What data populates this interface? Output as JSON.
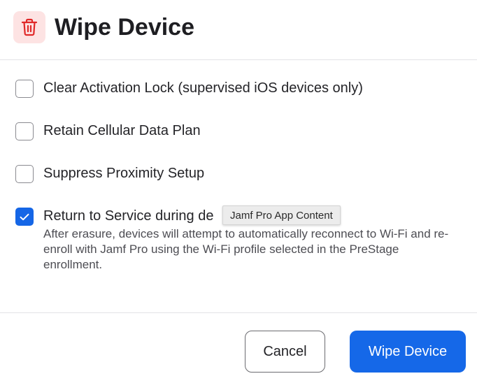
{
  "dialog": {
    "title": "Wipe Device",
    "icon": "trash-icon"
  },
  "options": [
    {
      "label": "Clear Activation Lock (supervised iOS devices only)",
      "checked": false
    },
    {
      "label": "Retain Cellular Data Plan",
      "checked": false
    },
    {
      "label": "Suppress Proximity Setup",
      "checked": false
    },
    {
      "label": "Return to Service during de",
      "checked": true,
      "description": "After erasure, devices will attempt to automatically reconnect to Wi-Fi and re-enroll with Jamf Pro using the Wi-Fi profile selected in the PreStage enrollment."
    }
  ],
  "tooltip": {
    "text": "Jamf Pro App Content"
  },
  "footer": {
    "cancel_label": "Cancel",
    "confirm_label": "Wipe Device"
  },
  "colors": {
    "primary": "#1568e8",
    "danger_icon": "#e02828",
    "danger_icon_bg": "#fde3e3"
  }
}
